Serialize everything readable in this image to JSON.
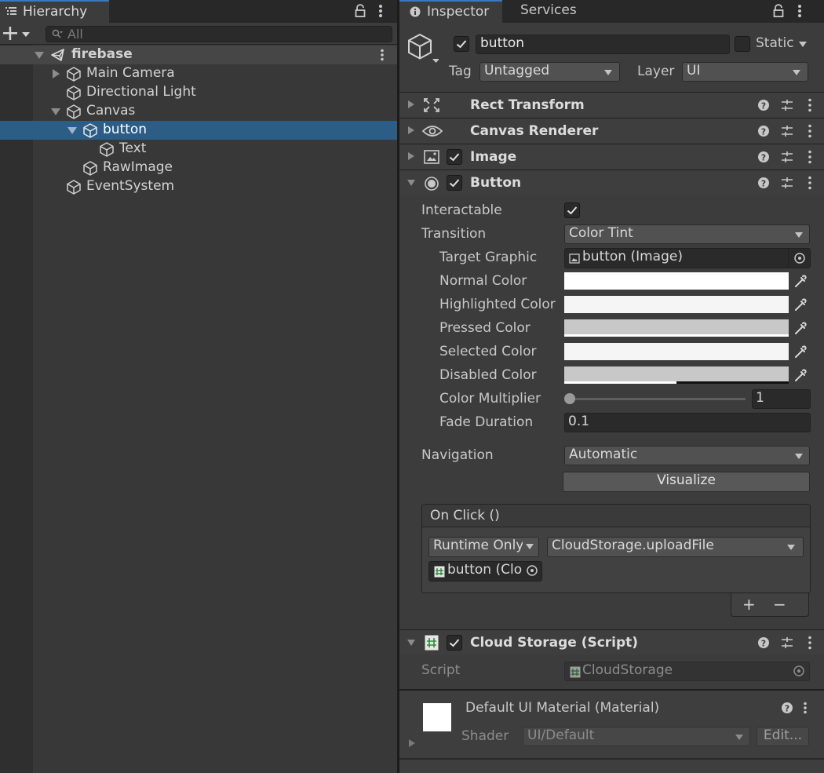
{
  "hierarchy": {
    "tab_label": "Hierarchy",
    "search_placeholder": "All",
    "scene": "firebase",
    "items": [
      {
        "label": "Main Camera"
      },
      {
        "label": "Directional Light"
      },
      {
        "label": "Canvas"
      },
      {
        "label": "button"
      },
      {
        "label": "Text"
      },
      {
        "label": "RawImage"
      },
      {
        "label": "EventSystem"
      }
    ]
  },
  "inspector": {
    "tabs": {
      "inspector": "Inspector",
      "services": "Services"
    },
    "object": {
      "name": "button",
      "static_label": "Static",
      "tag_label": "Tag",
      "tag_value": "Untagged",
      "layer_label": "Layer",
      "layer_value": "UI"
    },
    "components": {
      "rect_transform": "Rect Transform",
      "canvas_renderer": "Canvas Renderer",
      "image": "Image",
      "button": "Button",
      "cloud_storage": "Cloud Storage (Script)"
    },
    "button_props": {
      "interactable": "Interactable",
      "transition": "Transition",
      "transition_value": "Color Tint",
      "target_graphic": "Target Graphic",
      "target_graphic_value": "button (Image)",
      "normal_color": "Normal Color",
      "highlighted_color": "Highlighted Color",
      "pressed_color": "Pressed Color",
      "selected_color": "Selected Color",
      "disabled_color": "Disabled Color",
      "color_multiplier": "Color Multiplier",
      "color_multiplier_value": "1",
      "fade_duration": "Fade Duration",
      "fade_duration_value": "0.1",
      "navigation": "Navigation",
      "navigation_value": "Automatic",
      "visualize": "Visualize"
    },
    "colors": {
      "normal": "#ffffff",
      "highlighted": "#f5f5f5",
      "pressed": "#c8c8c8",
      "selected": "#f5f5f5",
      "disabled": "#c8c8c8",
      "accent": "#3a79bb",
      "selection": "#2c5d87"
    },
    "on_click": {
      "header": "On Click ()",
      "runtime": "Runtime Only",
      "function": "CloudStorage.uploadFile",
      "object": "button (Cloud Storage)",
      "add": "+",
      "remove": "−"
    },
    "script": {
      "label": "Script",
      "value": "CloudStorage"
    },
    "material": {
      "name": "Default UI Material (Material)",
      "shader_label": "Shader",
      "shader_value": "UI/Default",
      "edit_label": "Edit..."
    }
  }
}
